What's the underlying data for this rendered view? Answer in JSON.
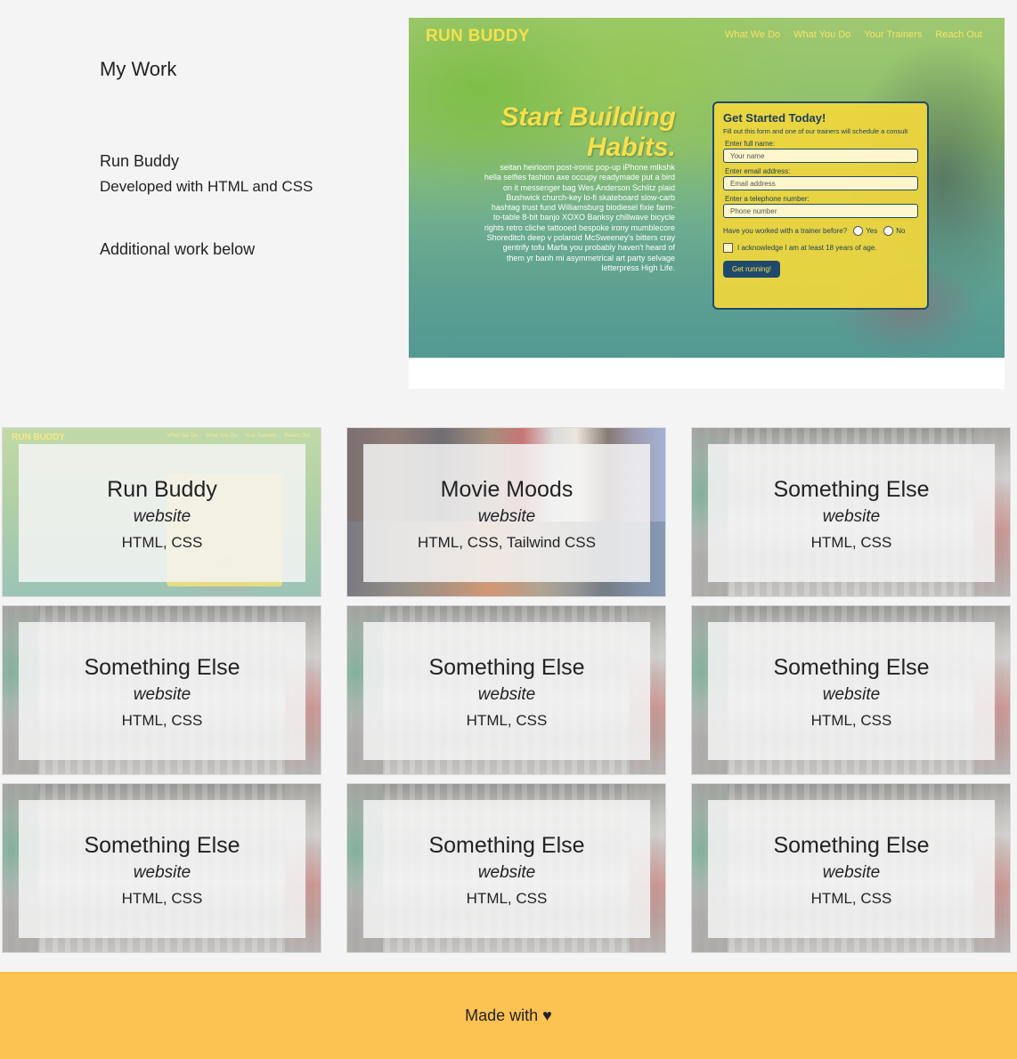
{
  "intro": {
    "title": "My Work",
    "featured_name": "Run Buddy",
    "featured_desc": "Developed with HTML and CSS",
    "more": "Additional work below"
  },
  "featured_screenshot": {
    "logo": "RUN BUDDY",
    "nav": [
      "What We Do",
      "What You Do",
      "Your Trainers",
      "Reach Out"
    ],
    "headline_1": "Start Building",
    "headline_2": "Habits.",
    "copy": "seitan heirloom post-ironic pop-up iPhone mlkshk hella selfies fashion axe occupy readymade put a bird on it messenger bag Wes Anderson Schlitz plaid Bushwick church-key lo-fi skateboard slow-carb hashtag trust fund Williamsburg biodiesel fixie farm-to-table 8-bit banjo XOXO Banksy chillwave bicycle rights retro cliche tattooed bespoke irony mumblecore Shoreditch deep v polaroid McSweeney's bitters cray gentrify tofu Marfa you probably haven't heard of them yr banh mi asymmetrical art party selvage letterpress High Life.",
    "form": {
      "title": "Get Started Today!",
      "subtitle": "Fill out this form and one of our trainers will schedule a consult",
      "name_label": "Enter full name:",
      "name_placeholder": "Your name",
      "email_label": "Enter email address:",
      "email_placeholder": "Email address",
      "phone_label": "Enter a telephone number:",
      "phone_placeholder": "Phone number",
      "trainer_question": "Have you worked with a trainer before?",
      "yes": "Yes",
      "no": "No",
      "ack": "I acknowledge I am at least 18 years of age.",
      "submit": "Get running!"
    }
  },
  "projects": [
    {
      "title": "Run Buddy",
      "type": "website",
      "tech": "HTML, CSS",
      "bg": "run"
    },
    {
      "title": "Movie Moods",
      "type": "website",
      "tech": "HTML, CSS, Tailwind CSS",
      "bg": "movie"
    },
    {
      "title": "Something Else",
      "type": "website",
      "tech": "HTML, CSS",
      "bg": "blur"
    },
    {
      "title": "Something Else",
      "type": "website",
      "tech": "HTML, CSS",
      "bg": "blur"
    },
    {
      "title": "Something Else",
      "type": "website",
      "tech": "HTML, CSS",
      "bg": "blur"
    },
    {
      "title": "Something Else",
      "type": "website",
      "tech": "HTML, CSS",
      "bg": "blur"
    },
    {
      "title": "Something Else",
      "type": "website",
      "tech": "HTML, CSS",
      "bg": "blur"
    },
    {
      "title": "Something Else",
      "type": "website",
      "tech": "HTML, CSS",
      "bg": "blur"
    },
    {
      "title": "Something Else",
      "type": "website",
      "tech": "HTML, CSS",
      "bg": "blur"
    }
  ],
  "footer": {
    "text": "Made with ♥"
  },
  "colors": {
    "footer_bg": "#fcc252",
    "page_bg": "#f4f4f4",
    "run_buddy_yellow": "#f7e04c",
    "run_buddy_navy": "#1f4a6e"
  }
}
